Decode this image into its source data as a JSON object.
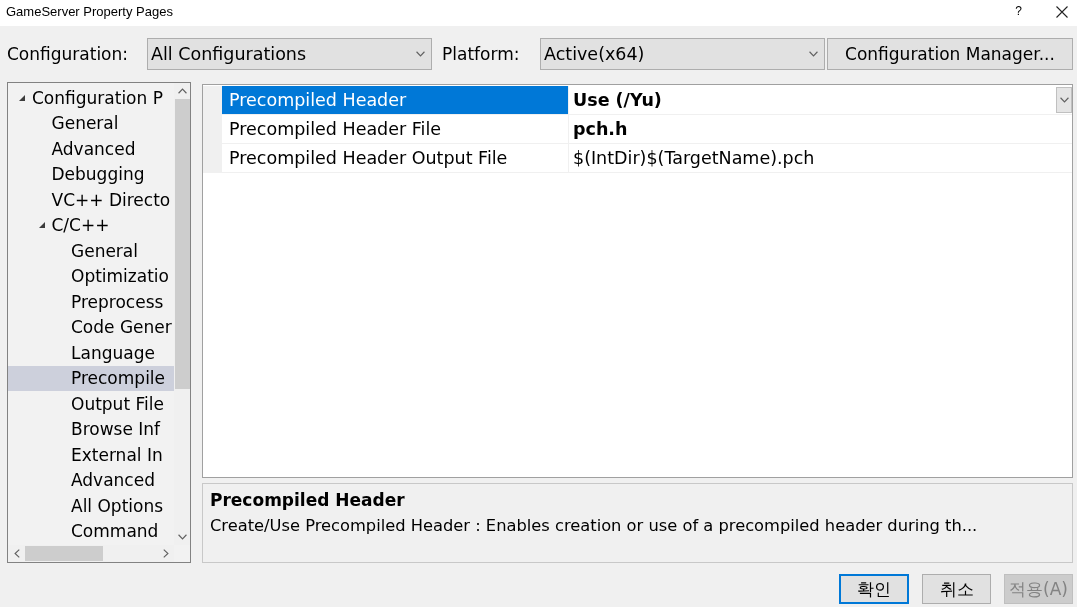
{
  "window": {
    "title": "GameServer Property Pages",
    "help_button": "?"
  },
  "toolbar": {
    "configuration_label": "Configuration:",
    "configuration_value": "All Configurations",
    "platform_label": "Platform:",
    "platform_value": "Active(x64)",
    "manager_button": "Configuration Manager..."
  },
  "tree": {
    "items": [
      {
        "label": "Configuration P",
        "selected": false,
        "expanded": true,
        "children": [
          {
            "label": "General",
            "selected": false
          },
          {
            "label": "Advanced",
            "selected": false
          },
          {
            "label": "Debugging",
            "selected": false
          },
          {
            "label": "VC++ Directo",
            "selected": false
          },
          {
            "label": "C/C++",
            "selected": false,
            "expanded": true,
            "children": [
              {
                "label": "General",
                "selected": false
              },
              {
                "label": "Optimizatio",
                "selected": false
              },
              {
                "label": "Preprocess",
                "selected": false
              },
              {
                "label": "Code Gener",
                "selected": false
              },
              {
                "label": "Language",
                "selected": false
              },
              {
                "label": "Precompile",
                "selected": true
              },
              {
                "label": "Output File",
                "selected": false
              },
              {
                "label": "Browse Inf",
                "selected": false
              },
              {
                "label": "External In",
                "selected": false
              },
              {
                "label": "Advanced",
                "selected": false
              },
              {
                "label": "All Options",
                "selected": false
              },
              {
                "label": "Command",
                "selected": false
              }
            ]
          }
        ]
      }
    ]
  },
  "properties": [
    {
      "name": "Precompiled Header",
      "value": "Use (/Yu)",
      "selected": true,
      "modified": true
    },
    {
      "name": "Precompiled Header File",
      "value": "pch.h",
      "selected": false,
      "modified": true
    },
    {
      "name": "Precompiled Header Output File",
      "value": "$(IntDir)$(TargetName).pch",
      "selected": false,
      "modified": false
    }
  ],
  "description": {
    "title": "Precompiled Header",
    "text": "Create/Use Precompiled Header : Enables creation or use of a precompiled header during th..."
  },
  "buttons": [
    {
      "label": "확인",
      "default": true,
      "disabled": false
    },
    {
      "label": "취소",
      "default": false,
      "disabled": false
    },
    {
      "label": "적용(A)",
      "default": false,
      "disabled": true
    }
  ]
}
